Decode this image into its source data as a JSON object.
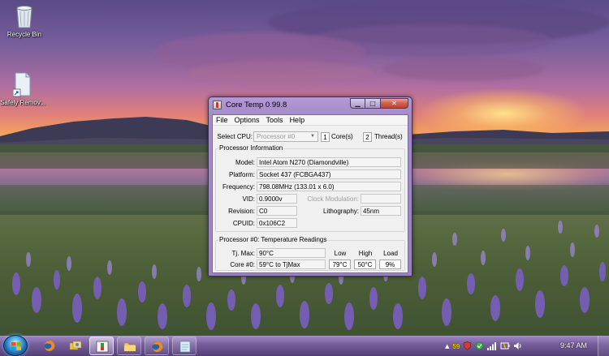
{
  "desktop": {
    "icons": [
      {
        "label": "Recycle Bin",
        "icon": "recycle-bin-icon"
      },
      {
        "label": "Safely Remov...",
        "icon": "usb-shortcut-icon"
      }
    ]
  },
  "window": {
    "title": "Core Temp 0.99.8",
    "menu": [
      "File",
      "Options",
      "Tools",
      "Help"
    ],
    "select_cpu": {
      "label": "Select CPU:",
      "value": "Processor #0",
      "cores_value": "1",
      "cores_label": "Core(s)",
      "threads_value": "2",
      "threads_label": "Thread(s)"
    },
    "processor_info": {
      "title": "Processor Information",
      "model_label": "Model:",
      "model": "Intel Atom N270 (Diamondville)",
      "platform_label": "Platform:",
      "platform": "Socket 437 (FCBGA437)",
      "frequency_label": "Frequency:",
      "frequency": "798.08MHz (133.01 x 6.0)",
      "vid_label": "VID:",
      "vid": "0.9000v",
      "clock_mod_label": "Clock Modulation:",
      "clock_mod": "",
      "revision_label": "Revision:",
      "revision": "C0",
      "lithography_label": "Lithography:",
      "lithography": "45nm",
      "cpuid_label": "CPUID:",
      "cpuid": "0x106C2"
    },
    "temperature": {
      "title": "Processor #0: Temperature Readings",
      "tjmax_label": "Tj. Max:",
      "tjmax": "90°C",
      "col_low": "Low",
      "col_high": "High",
      "col_load": "Load",
      "core_label": "Core #0:",
      "core_reading": "59°C to TjMax",
      "low": "79°C",
      "high": "50°C",
      "load": "9%"
    }
  },
  "taskbar": {
    "buttons": [
      "start-button",
      "firefox-icon",
      "windows-explorer-icon",
      "core-temp-icon",
      "folder-icon",
      "firefox-icon",
      "notepad-icon"
    ],
    "tray_temp": "59",
    "clock": "9:47 AM"
  },
  "colors": {
    "tray_temp": "#f4d000",
    "taskbar": "#6e5596",
    "window_frame": "#a48bc9"
  }
}
